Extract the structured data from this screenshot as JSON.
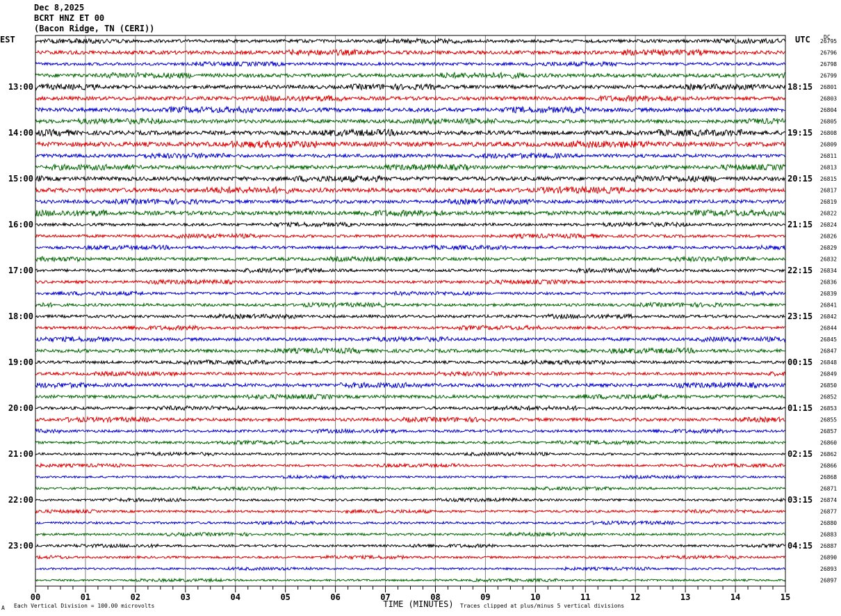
{
  "header": {
    "date": "Dec 8,2025",
    "station": "BCRT HNZ ET 00",
    "location": "(Bacon Ridge, TN (CERI))"
  },
  "left_timezone": "EST",
  "right_timezone": "UTC",
  "dc_label": "DC",
  "footer": {
    "scale_note": "Each Vertical Division =  100.00 microvolts",
    "clip_note": "Traces clipped at plus/minus 5 vertical divisions",
    "corner_mark": "A"
  },
  "colors": {
    "trace_cycle": [
      "#000000",
      "#dd0000",
      "#0000cc",
      "#006600"
    ],
    "grid": "#808080"
  },
  "chart_data": {
    "type": "line",
    "title": "",
    "xlabel": "TIME (MINUTES)",
    "ylabel": "",
    "xlim": [
      0,
      15
    ],
    "x_ticks": [
      "00",
      "01",
      "02",
      "03",
      "04",
      "05",
      "06",
      "07",
      "08",
      "09",
      "10",
      "11",
      "12",
      "13",
      "14",
      "15"
    ],
    "x_minor_per_major": 4,
    "grid": true,
    "rows_per_hour": 4,
    "left_hour_labels": [
      "13:00",
      "14:00",
      "15:00",
      "16:00",
      "17:00",
      "18:00",
      "19:00",
      "20:00",
      "21:00",
      "22:00",
      "23:00"
    ],
    "right_hour_labels": [
      "18:15",
      "19:15",
      "20:15",
      "21:15",
      "22:15",
      "23:15",
      "00:15",
      "01:15",
      "02:15",
      "03:15",
      "04:15"
    ],
    "first_labeled_row": 4,
    "dc_offsets": [
      "26795",
      "26796",
      "26798",
      "26799",
      "26801",
      "26803",
      "26804",
      "26805",
      "26808",
      "26809",
      "26811",
      "26813",
      "26815",
      "26817",
      "26819",
      "26822",
      "26824",
      "26826",
      "26829",
      "26832",
      "26834",
      "26836",
      "26839",
      "26841",
      "26842",
      "26844",
      "26845",
      "26847",
      "26848",
      "26849",
      "26850",
      "26852",
      "26853",
      "26855",
      "26857",
      "26860",
      "26862",
      "26866",
      "26868",
      "26871",
      "26874",
      "26877",
      "26880",
      "26883",
      "26887",
      "26890",
      "26893",
      "26897"
    ],
    "trace_amplitude": [
      2.2,
      2.6,
      2.0,
      2.6,
      2.6,
      2.6,
      2.8,
      2.6,
      3.0,
      3.2,
      2.4,
      2.6,
      2.8,
      3.0,
      2.4,
      2.8,
      2.0,
      2.0,
      2.0,
      2.2,
      2.0,
      2.0,
      1.8,
      2.0,
      2.0,
      2.0,
      2.2,
      2.4,
      2.0,
      2.0,
      2.4,
      2.2,
      2.0,
      2.2,
      1.8,
      1.8,
      1.6,
      1.6,
      1.4,
      1.6,
      1.6,
      1.6,
      1.6,
      1.6,
      1.6,
      1.6,
      1.4,
      1.4
    ]
  }
}
